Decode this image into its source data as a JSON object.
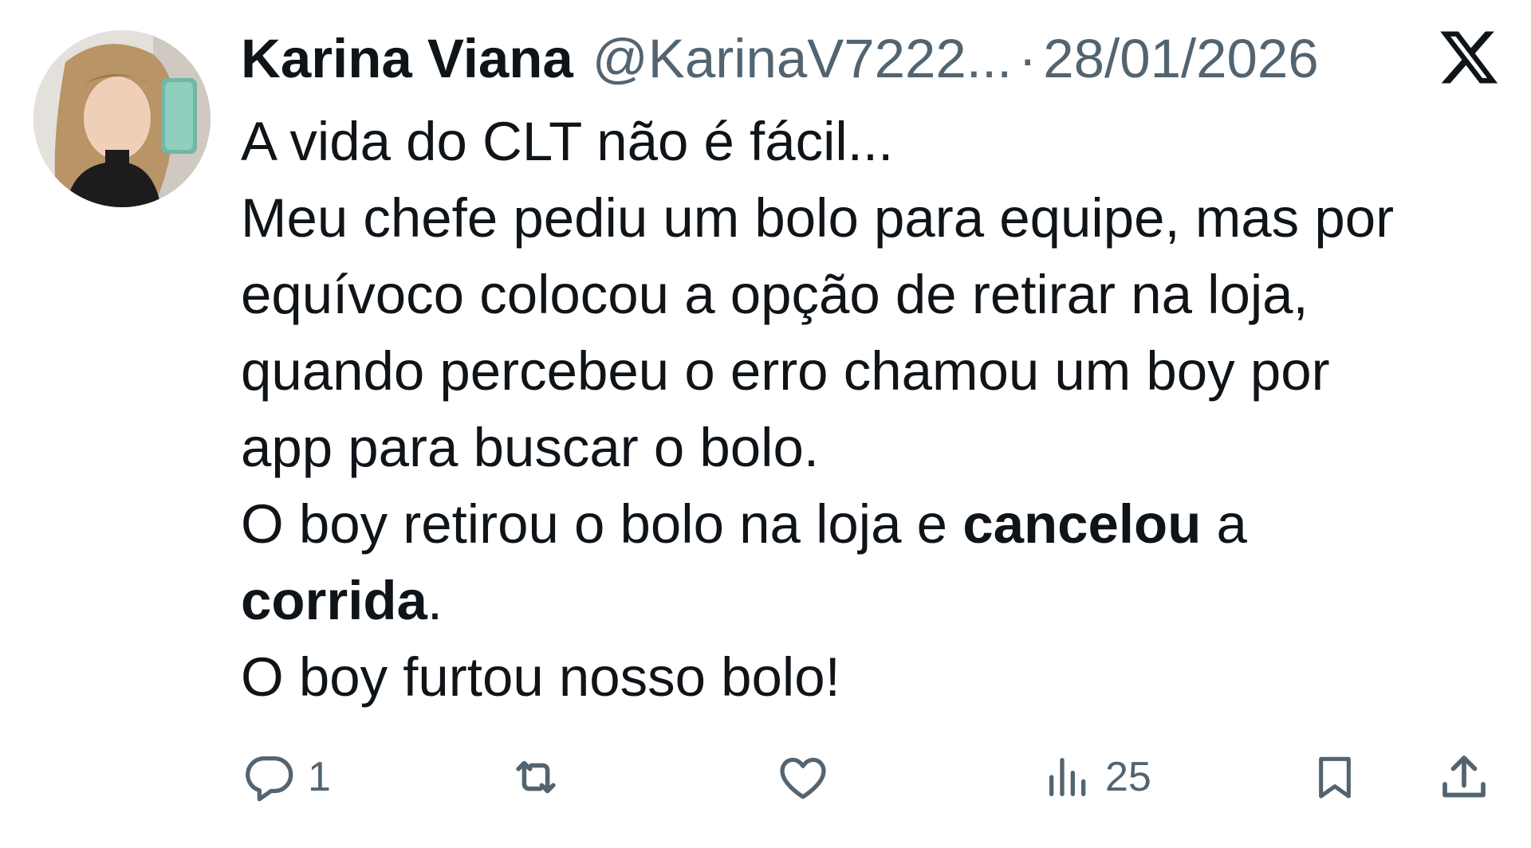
{
  "tweet": {
    "author": {
      "display_name": "Karina Viana",
      "handle": "@KarinaV7222...",
      "separator": "·",
      "date": "28/01/2026"
    },
    "platform_icon": "x-logo-icon",
    "lines": [
      "A vida do CLT não é fácil...",
      "Meu chefe pediu um bolo para equipe, mas por",
      "equívoco colocou a opção de retirar na loja,",
      "quando percebeu o erro chamou um boy por",
      "app para buscar o bolo."
    ],
    "line6": {
      "before": "O boy retirou o bolo na loja e ",
      "bold": "cancelou",
      "after": " a"
    },
    "line7": {
      "bold": "corrida",
      "after": "."
    },
    "last_line": "O boy furtou nosso bolo!",
    "actions": {
      "reply": {
        "icon": "reply-icon",
        "count": "1"
      },
      "retweet": {
        "icon": "retweet-icon",
        "count": ""
      },
      "like": {
        "icon": "heart-icon",
        "count": ""
      },
      "views": {
        "icon": "views-icon",
        "count": "25"
      },
      "bookmark": {
        "icon": "bookmark-icon"
      },
      "share": {
        "icon": "share-icon"
      }
    }
  },
  "colors": {
    "text": "#0f1419",
    "secondary": "#536471",
    "background": "#ffffff"
  }
}
